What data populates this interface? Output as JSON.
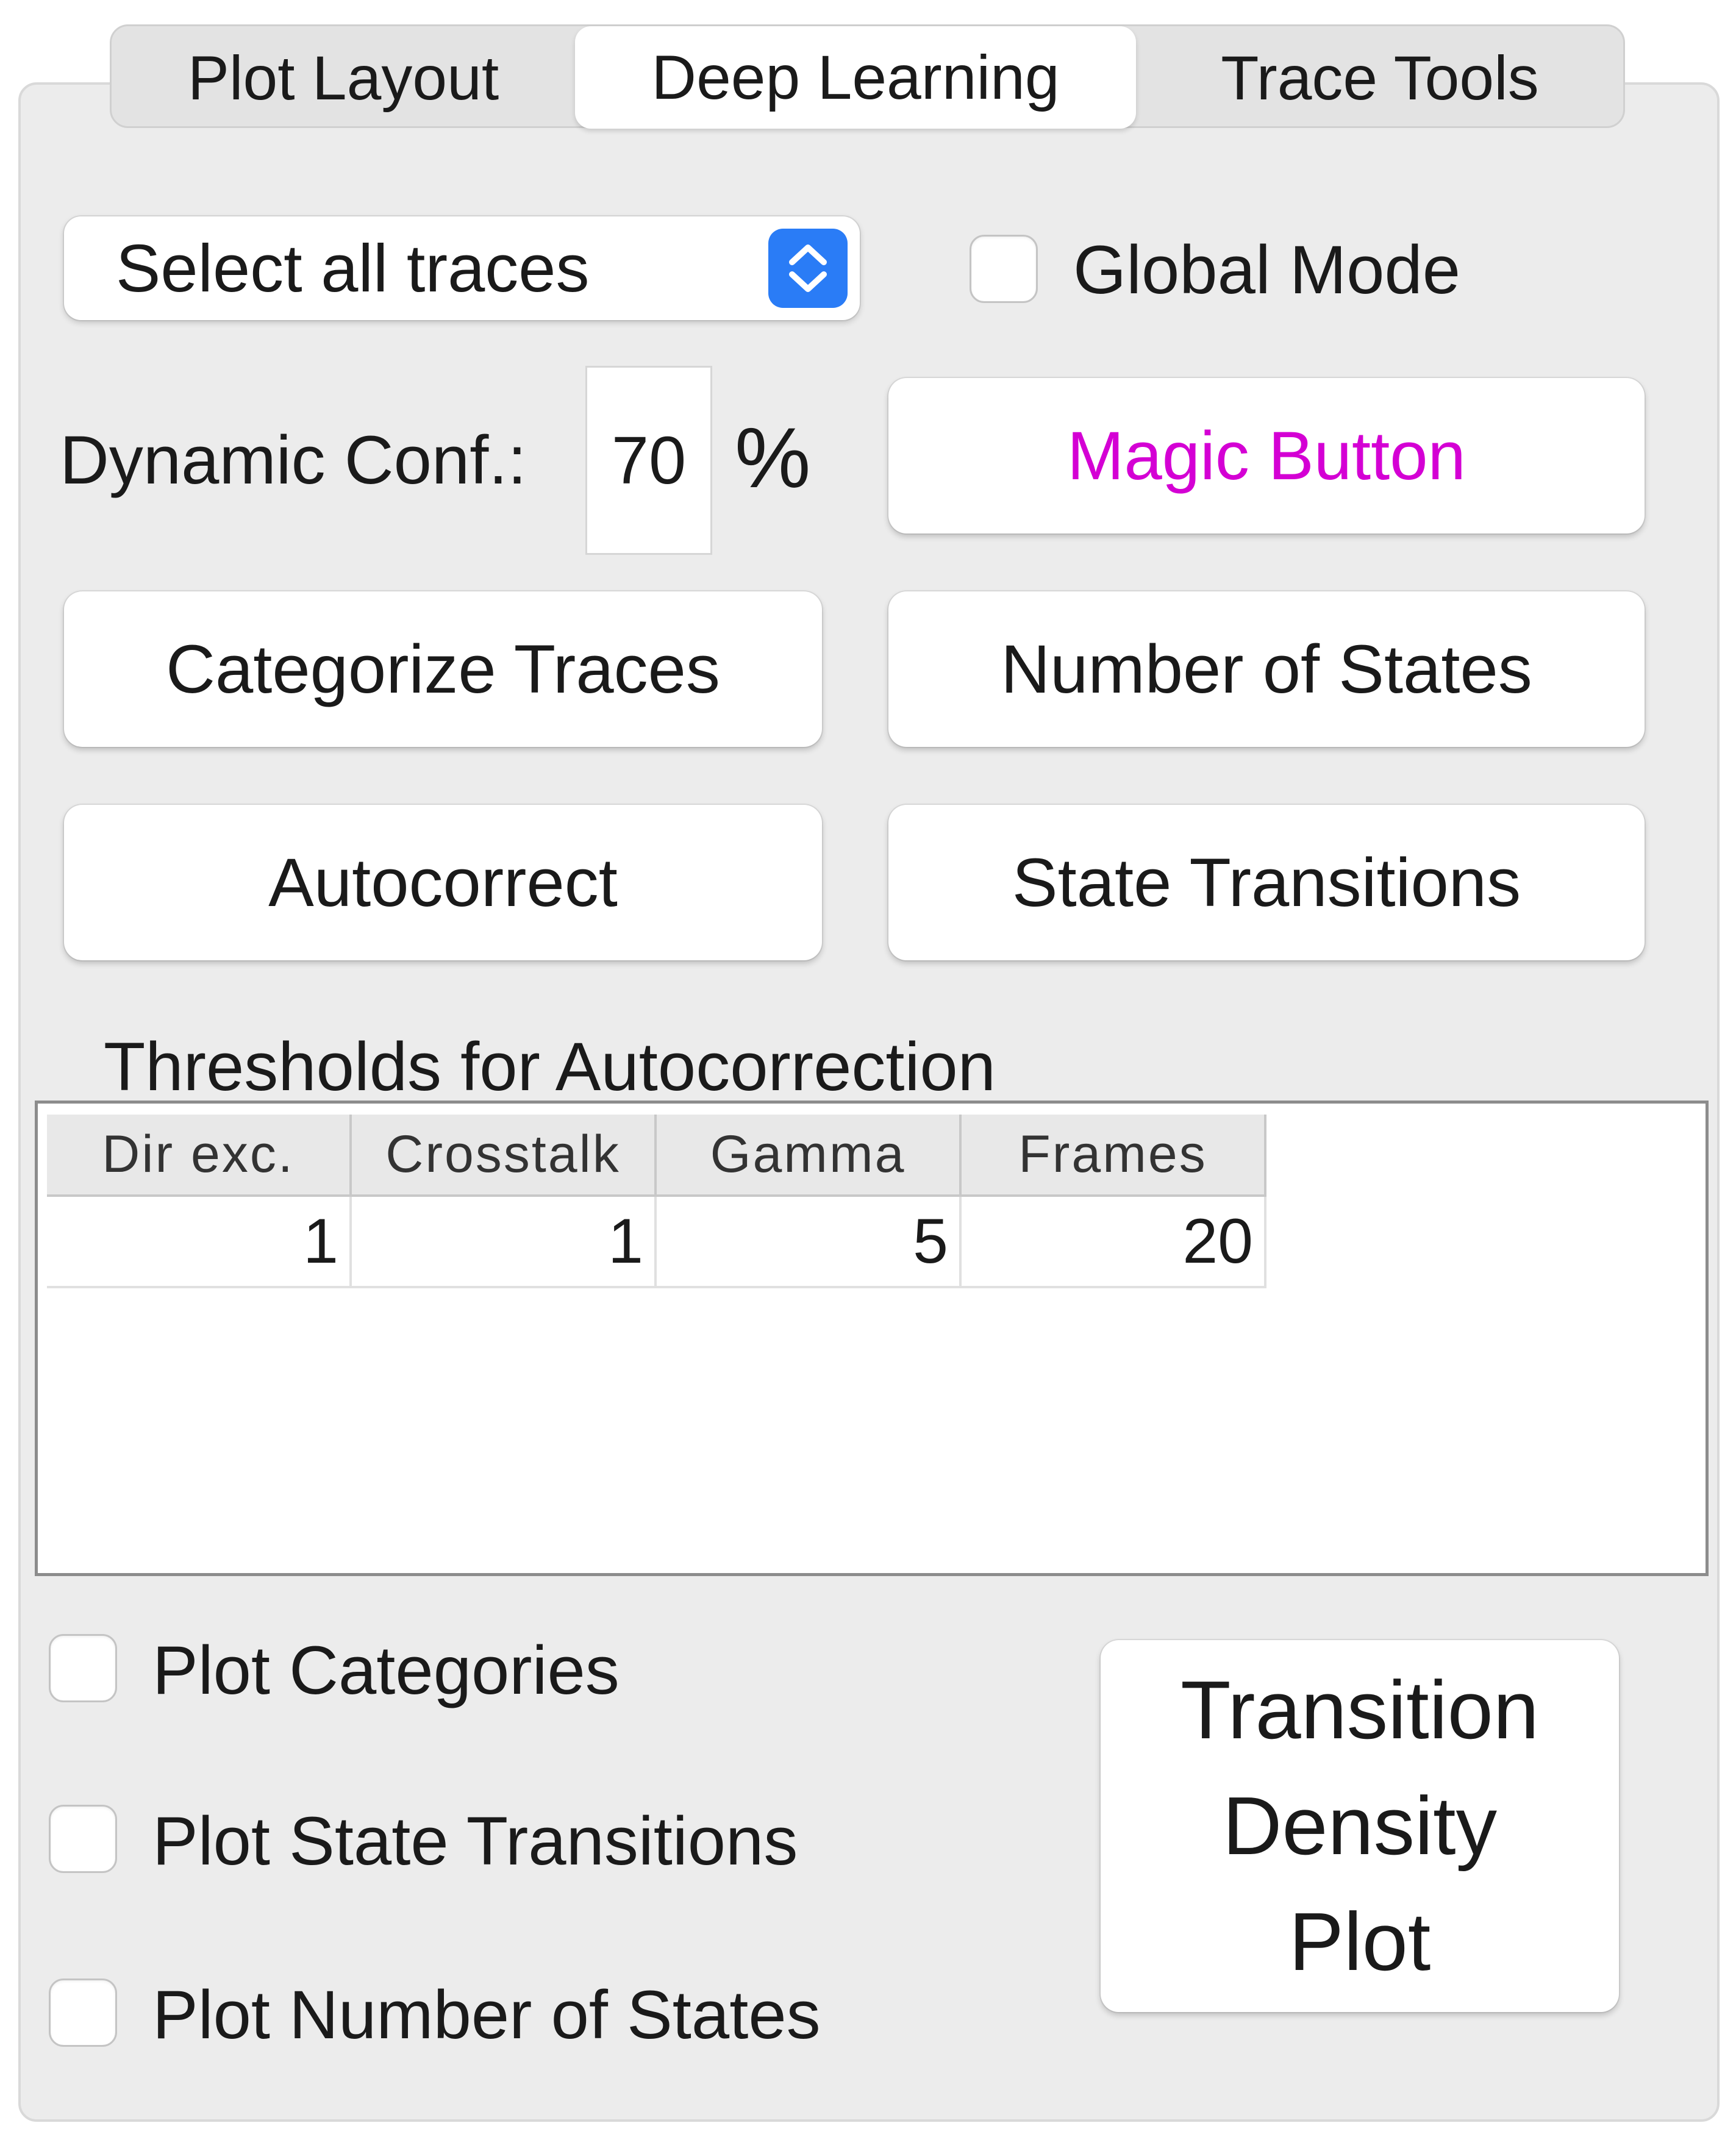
{
  "tabs": [
    {
      "label": "Plot Layout",
      "active": false
    },
    {
      "label": "Deep Learning",
      "active": true
    },
    {
      "label": "Trace Tools",
      "active": false
    }
  ],
  "select": {
    "value": "Select all traces"
  },
  "global_mode": {
    "label": "Global Mode",
    "checked": false
  },
  "dynamic_conf": {
    "label": "Dynamic Conf.:",
    "value": "70",
    "unit": "%"
  },
  "buttons": {
    "magic": "Magic Button",
    "categorize": "Categorize Traces",
    "num_states": "Number of States",
    "autocorrect": "Autocorrect",
    "state_transitions": "State Transitions",
    "tdp_line1": "Transition",
    "tdp_line2": "Density",
    "tdp_line3": "Plot"
  },
  "colors": {
    "magic_text": "#d400d4",
    "select_accent": "#2a7cf6"
  },
  "thresholds": {
    "title": "Thresholds for Autocorrection",
    "headers": [
      "Dir exc.",
      "Crosstalk",
      "Gamma",
      "Frames"
    ],
    "rows": [
      [
        "1",
        "1",
        "5",
        "20"
      ]
    ]
  },
  "checkboxes": [
    {
      "label": "Plot Categories",
      "checked": false
    },
    {
      "label": "Plot State Transitions",
      "checked": false
    },
    {
      "label": "Plot Number of States",
      "checked": false
    }
  ]
}
